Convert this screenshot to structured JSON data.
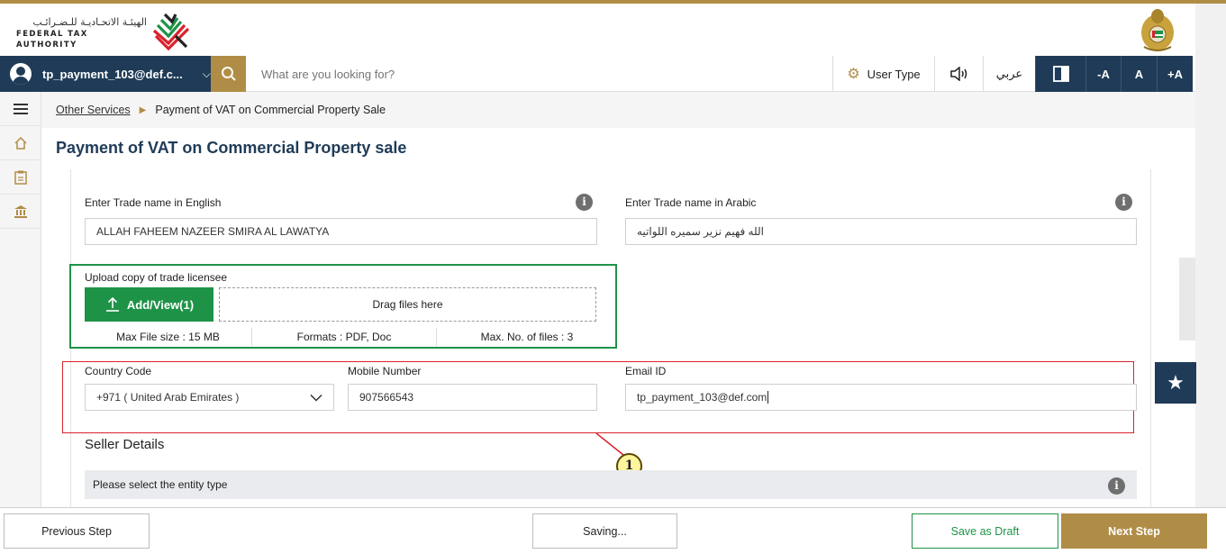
{
  "header": {
    "logo_arabic": "الهيئـة الاتحـاديـة للـضـرائـب",
    "logo_english": "FEDERAL TAX AUTHORITY"
  },
  "navbar": {
    "user_email": "tp_payment_103@def.c...",
    "search_placeholder": "What are you looking for?",
    "user_type_label": "User Type",
    "language_label": "عربي",
    "font_decrease": "-A",
    "font_normal": "A",
    "font_increase": "+A"
  },
  "breadcrumb": {
    "parent": "Other Services",
    "current": "Payment of VAT on Commercial Property Sale"
  },
  "page": {
    "title": "Payment of VAT on Commercial Property sale"
  },
  "form": {
    "trade_name_en_label": "Enter Trade name in English",
    "trade_name_en_value": "ALLAH FAHEEM NAZEER SMIRA AL LAWATYA",
    "trade_name_ar_label": "Enter Trade name in Arabic",
    "trade_name_ar_value": "الله فهيم نزير سميره اللواتيه",
    "upload_label": "Upload copy of trade licensee",
    "upload_button": "Add/View(1)",
    "drop_text": "Drag files here",
    "max_size": "Max File size : 15 MB",
    "formats": "Formats : PDF, Doc",
    "max_files": "Max. No. of files : 3",
    "country_code_label": "Country Code",
    "country_code_value": "+971 ( United Arab Emirates )",
    "mobile_label": "Mobile Number",
    "mobile_value": "907566543",
    "email_label": "Email ID",
    "email_value": "tp_payment_103@def.com",
    "seller_section": "Seller Details",
    "entity_prompt": "Please select the entity type"
  },
  "annotation": {
    "callout_number": "1"
  },
  "footer": {
    "previous": "Previous Step",
    "saving": "Saving...",
    "save_draft": "Save as Draft",
    "next": "Next Step"
  },
  "colors": {
    "navy": "#1f3b57",
    "gold": "#b08d46",
    "green": "#1e9347",
    "red": "#d9232d"
  }
}
